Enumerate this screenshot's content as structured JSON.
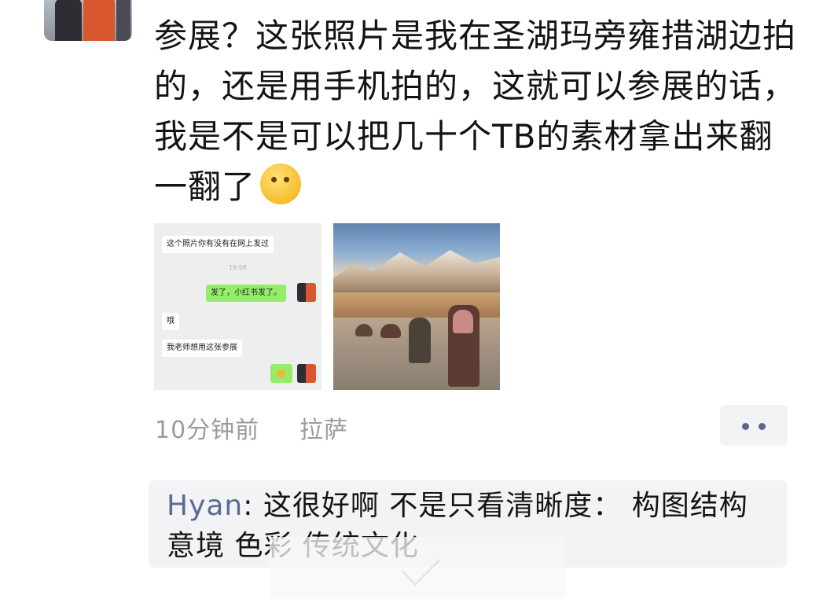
{
  "post": {
    "text": "参展？这张照片是我在圣湖玛旁雍措湖边拍的，还是用手机拍的，这就可以参展的话，我是不是可以把几十个TB的素材拿出来翻一翻了",
    "emoji": "thinking-face"
  },
  "thumbnail_chat": {
    "msg1": "这个照片你有没有在网上发过",
    "time": "19:08",
    "msg2": "发了，小红书发了。",
    "msg3": "哦",
    "msg4": "我老师想用这张参展"
  },
  "meta": {
    "time_ago": "10分钟前",
    "location": "拉萨"
  },
  "comment": {
    "author": "Hyan",
    "separator": ": ",
    "text": "这很好啊  不是只看清晰度：  构图结构  意境  色彩  传统文化"
  },
  "colors": {
    "link_blue": "#576b95",
    "meta_gray": "#9b9b9b",
    "comment_bg": "#f3f3f5",
    "wechat_green": "#95ec69"
  }
}
